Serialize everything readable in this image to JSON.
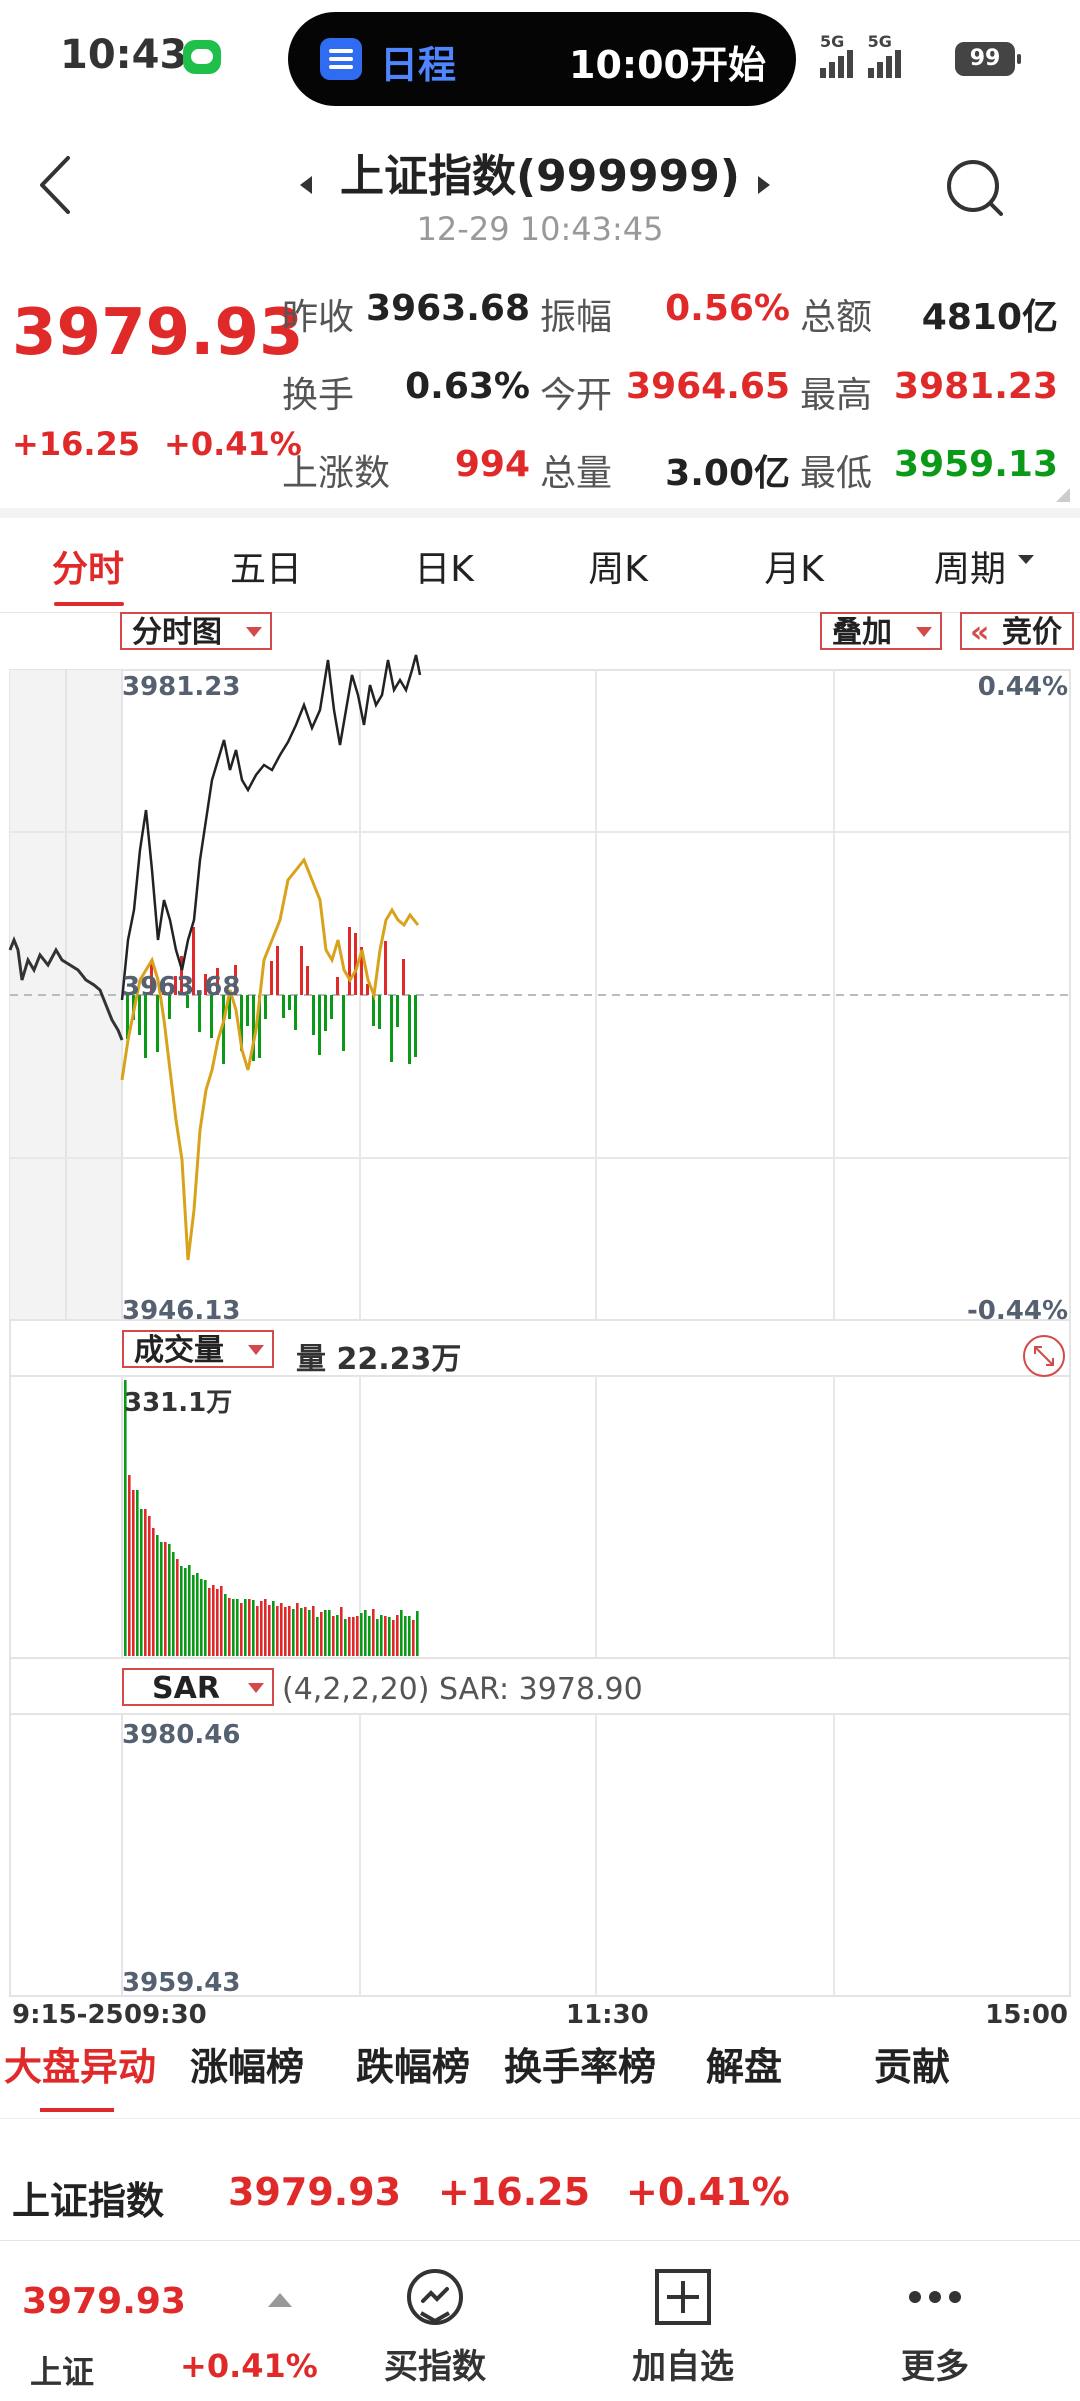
{
  "status_bar": {
    "time": "10:43",
    "island_label": "日程",
    "island_time": "10:00开始",
    "network1": "5G",
    "network2": "5G",
    "battery": "99"
  },
  "header": {
    "title": "上证指数(999999)",
    "subtitle": "12-29 10:43:45"
  },
  "quote": {
    "price": "3979.93",
    "change": "+16.25",
    "change_pct": "+0.41%",
    "fields": [
      {
        "label": "昨收",
        "value": "3963.68",
        "color": "#222222"
      },
      {
        "label": "振幅",
        "value": "0.56%",
        "color": "#e02a2a"
      },
      {
        "label": "总额",
        "value": "4810亿",
        "color": "#222222"
      },
      {
        "label": "换手",
        "value": "0.63%",
        "color": "#222222"
      },
      {
        "label": "今开",
        "value": "3964.65",
        "color": "#e02a2a"
      },
      {
        "label": "最高",
        "value": "3981.23",
        "color": "#e02a2a"
      },
      {
        "label": "上涨数",
        "value": "994",
        "color": "#e02a2a"
      },
      {
        "label": "总量",
        "value": "3.00亿",
        "color": "#222222"
      },
      {
        "label": "最低",
        "value": "3959.13",
        "color": "#0a9a17"
      }
    ]
  },
  "period_tabs": [
    "分时",
    "五日",
    "日K",
    "周K",
    "月K",
    "周期"
  ],
  "chart": {
    "view_select": "分时图",
    "overlay_select": "叠加",
    "auction_toggle": "竞价",
    "price_high": "3981.23",
    "price_low": "3946.13",
    "pct_high": "0.44%",
    "pct_low": "-0.44%",
    "prev_close_label": "3963.68",
    "volume_select": "成交量",
    "volume_text": "量 22.23万",
    "volume_max": "331.1万",
    "indicator_select": "SAR",
    "indicator_text": "(4,2,2,20) SAR: 3978.90",
    "sar_high": "3980.46",
    "sar_low": "3959.43",
    "time_labels": [
      "9:15-25",
      "09:30",
      "11:30",
      "15:00"
    ]
  },
  "bottom_tabs": [
    "大盘异动",
    "涨幅榜",
    "跌幅榜",
    "换手率榜",
    "解盘",
    "贡献"
  ],
  "list_row": {
    "name": "上证指数",
    "price": "3979.93",
    "change": "+16.25",
    "change_pct": "+0.41%"
  },
  "bottom_bar": {
    "price": "3979.93",
    "name": "上证",
    "change_pct": "+0.41%",
    "buy_label": "买指数",
    "add_label": "加自选",
    "more_label": "更多"
  },
  "colors": {
    "up": "#e02a2a",
    "down": "#0a9a17",
    "avg_line": "#d9a21b",
    "price_line": "#222222",
    "island": "#050505",
    "island_accent": "#2f6cf2"
  }
}
